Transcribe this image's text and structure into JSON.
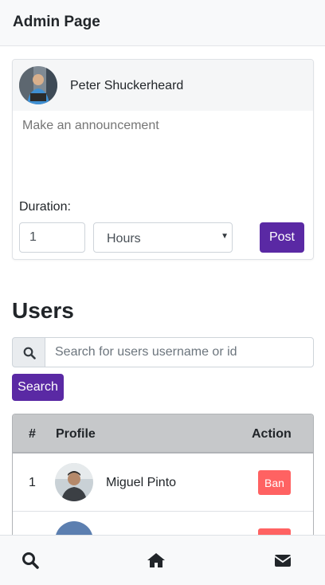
{
  "header": {
    "title": "Admin Page"
  },
  "announcement": {
    "user_name": "Peter Shuckerheard",
    "placeholder": "Make an announcement",
    "duration_label": "Duration:",
    "duration_value": "1",
    "unit_selected": "Hours",
    "post_label": "Post"
  },
  "users": {
    "title": "Users",
    "search_placeholder": "Search for users username or id",
    "search_button": "Search",
    "columns": [
      "#",
      "Profile",
      "Action"
    ],
    "rows": [
      {
        "num": "1",
        "name": "Miguel Pinto",
        "action": "Ban"
      },
      {
        "num": "",
        "name": "",
        "action": ""
      }
    ]
  },
  "nav": {
    "icons": [
      "search-icon",
      "home-icon",
      "envelope-icon"
    ]
  },
  "colors": {
    "primary": "#5a29a4",
    "danger": "#ff6262",
    "header_bg": "#c6c8ca"
  }
}
